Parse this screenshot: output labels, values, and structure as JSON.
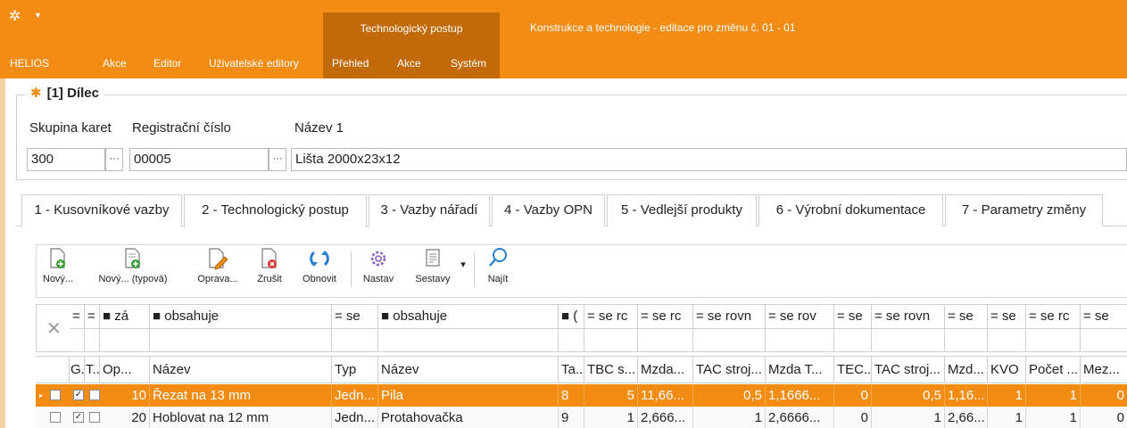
{
  "window": {
    "title": "Konstrukce a technologie - editace pro změnu č. 01 - 01",
    "context_tab": "Technologický postup",
    "qa_dropdown": "▼"
  },
  "menu": {
    "helios": "HELIOS",
    "akce": "Akce",
    "editor": "Editor",
    "uzivatelske": "Uživatelské editory",
    "prehled": "Přehled",
    "akce2": "Akce",
    "system": "Systém"
  },
  "header": {
    "group_title": "[1] Dílec",
    "skupina_label": "Skupina karet",
    "skupina_value": "300",
    "reg_label": "Registrační číslo",
    "reg_value": "00005",
    "nazev_label": "Název 1",
    "nazev_value": "Lišta 2000x23x12",
    "ellipsis": "···"
  },
  "tabs": [
    {
      "label": "1 - Kusovníkové vazby"
    },
    {
      "label": "2 - Technologický postup"
    },
    {
      "label": "3 - Vazby nářadí"
    },
    {
      "label": "4 - Vazby OPN"
    },
    {
      "label": "5 - Vedlejší produkty"
    },
    {
      "label": "6 - Výrobní dokumentace"
    },
    {
      "label": "7 - Parametry změny"
    }
  ],
  "toolbar": {
    "novy": "Nový...",
    "novy_typova": "Nový... (typová)",
    "oprava": "Oprava...",
    "zrusit": "Zrušit",
    "obnovit": "Obnovit",
    "nastav": "Nastav",
    "sestavy": "Sestavy",
    "najit": "Najít"
  },
  "filter": {
    "eq": "=",
    "za": "■ zá",
    "obsahuje": "■ obsahuje",
    "se": "= se",
    "box": "■ (",
    "se_rc": "= se rc",
    "se_rovn": "= se rovn",
    "se_rov": "= se rov",
    "se_short": "= se",
    "clear": "✕"
  },
  "grid": {
    "headers": [
      "G..",
      "T...",
      "Op...",
      "Název",
      "Typ",
      "Název",
      "Ta...",
      "TBC s...",
      "Mzda...",
      "TAC stroj...",
      "Mzda T...",
      "TEC...",
      "TAC stroj...",
      "Mzd...",
      "KVO",
      "Počet ...",
      "Mez..."
    ],
    "rows": [
      {
        "op": "10",
        "nazev": "Řezat na 13 mm",
        "typ": "Jedn...",
        "nazev2": "Pila",
        "ta": "8",
        "tbc": "5",
        "mzda": "11,66...",
        "tac": "0,5",
        "mzdat": "1,1666...",
        "tec": "0",
        "tac2": "0,5",
        "mzd": "1,16...",
        "kvo": "1",
        "pocet": "1",
        "mez": "0",
        "checked_g": true,
        "checked_t": false
      },
      {
        "op": "20",
        "nazev": "Hoblovat na 12 mm",
        "typ": "Jedn...",
        "nazev2": "Protahovačka",
        "ta": "9",
        "tbc": "1",
        "mzda": "2,666...",
        "tac": "1",
        "mzdat": "2,6666...",
        "tec": "0",
        "tac2": "1",
        "mzd": "2,66...",
        "kvo": "1",
        "pocet": "1",
        "mez": "0",
        "checked_g": true,
        "checked_t": false
      }
    ]
  },
  "colors": {
    "accent": "#f28c12",
    "accent_dark": "#c26a07"
  }
}
